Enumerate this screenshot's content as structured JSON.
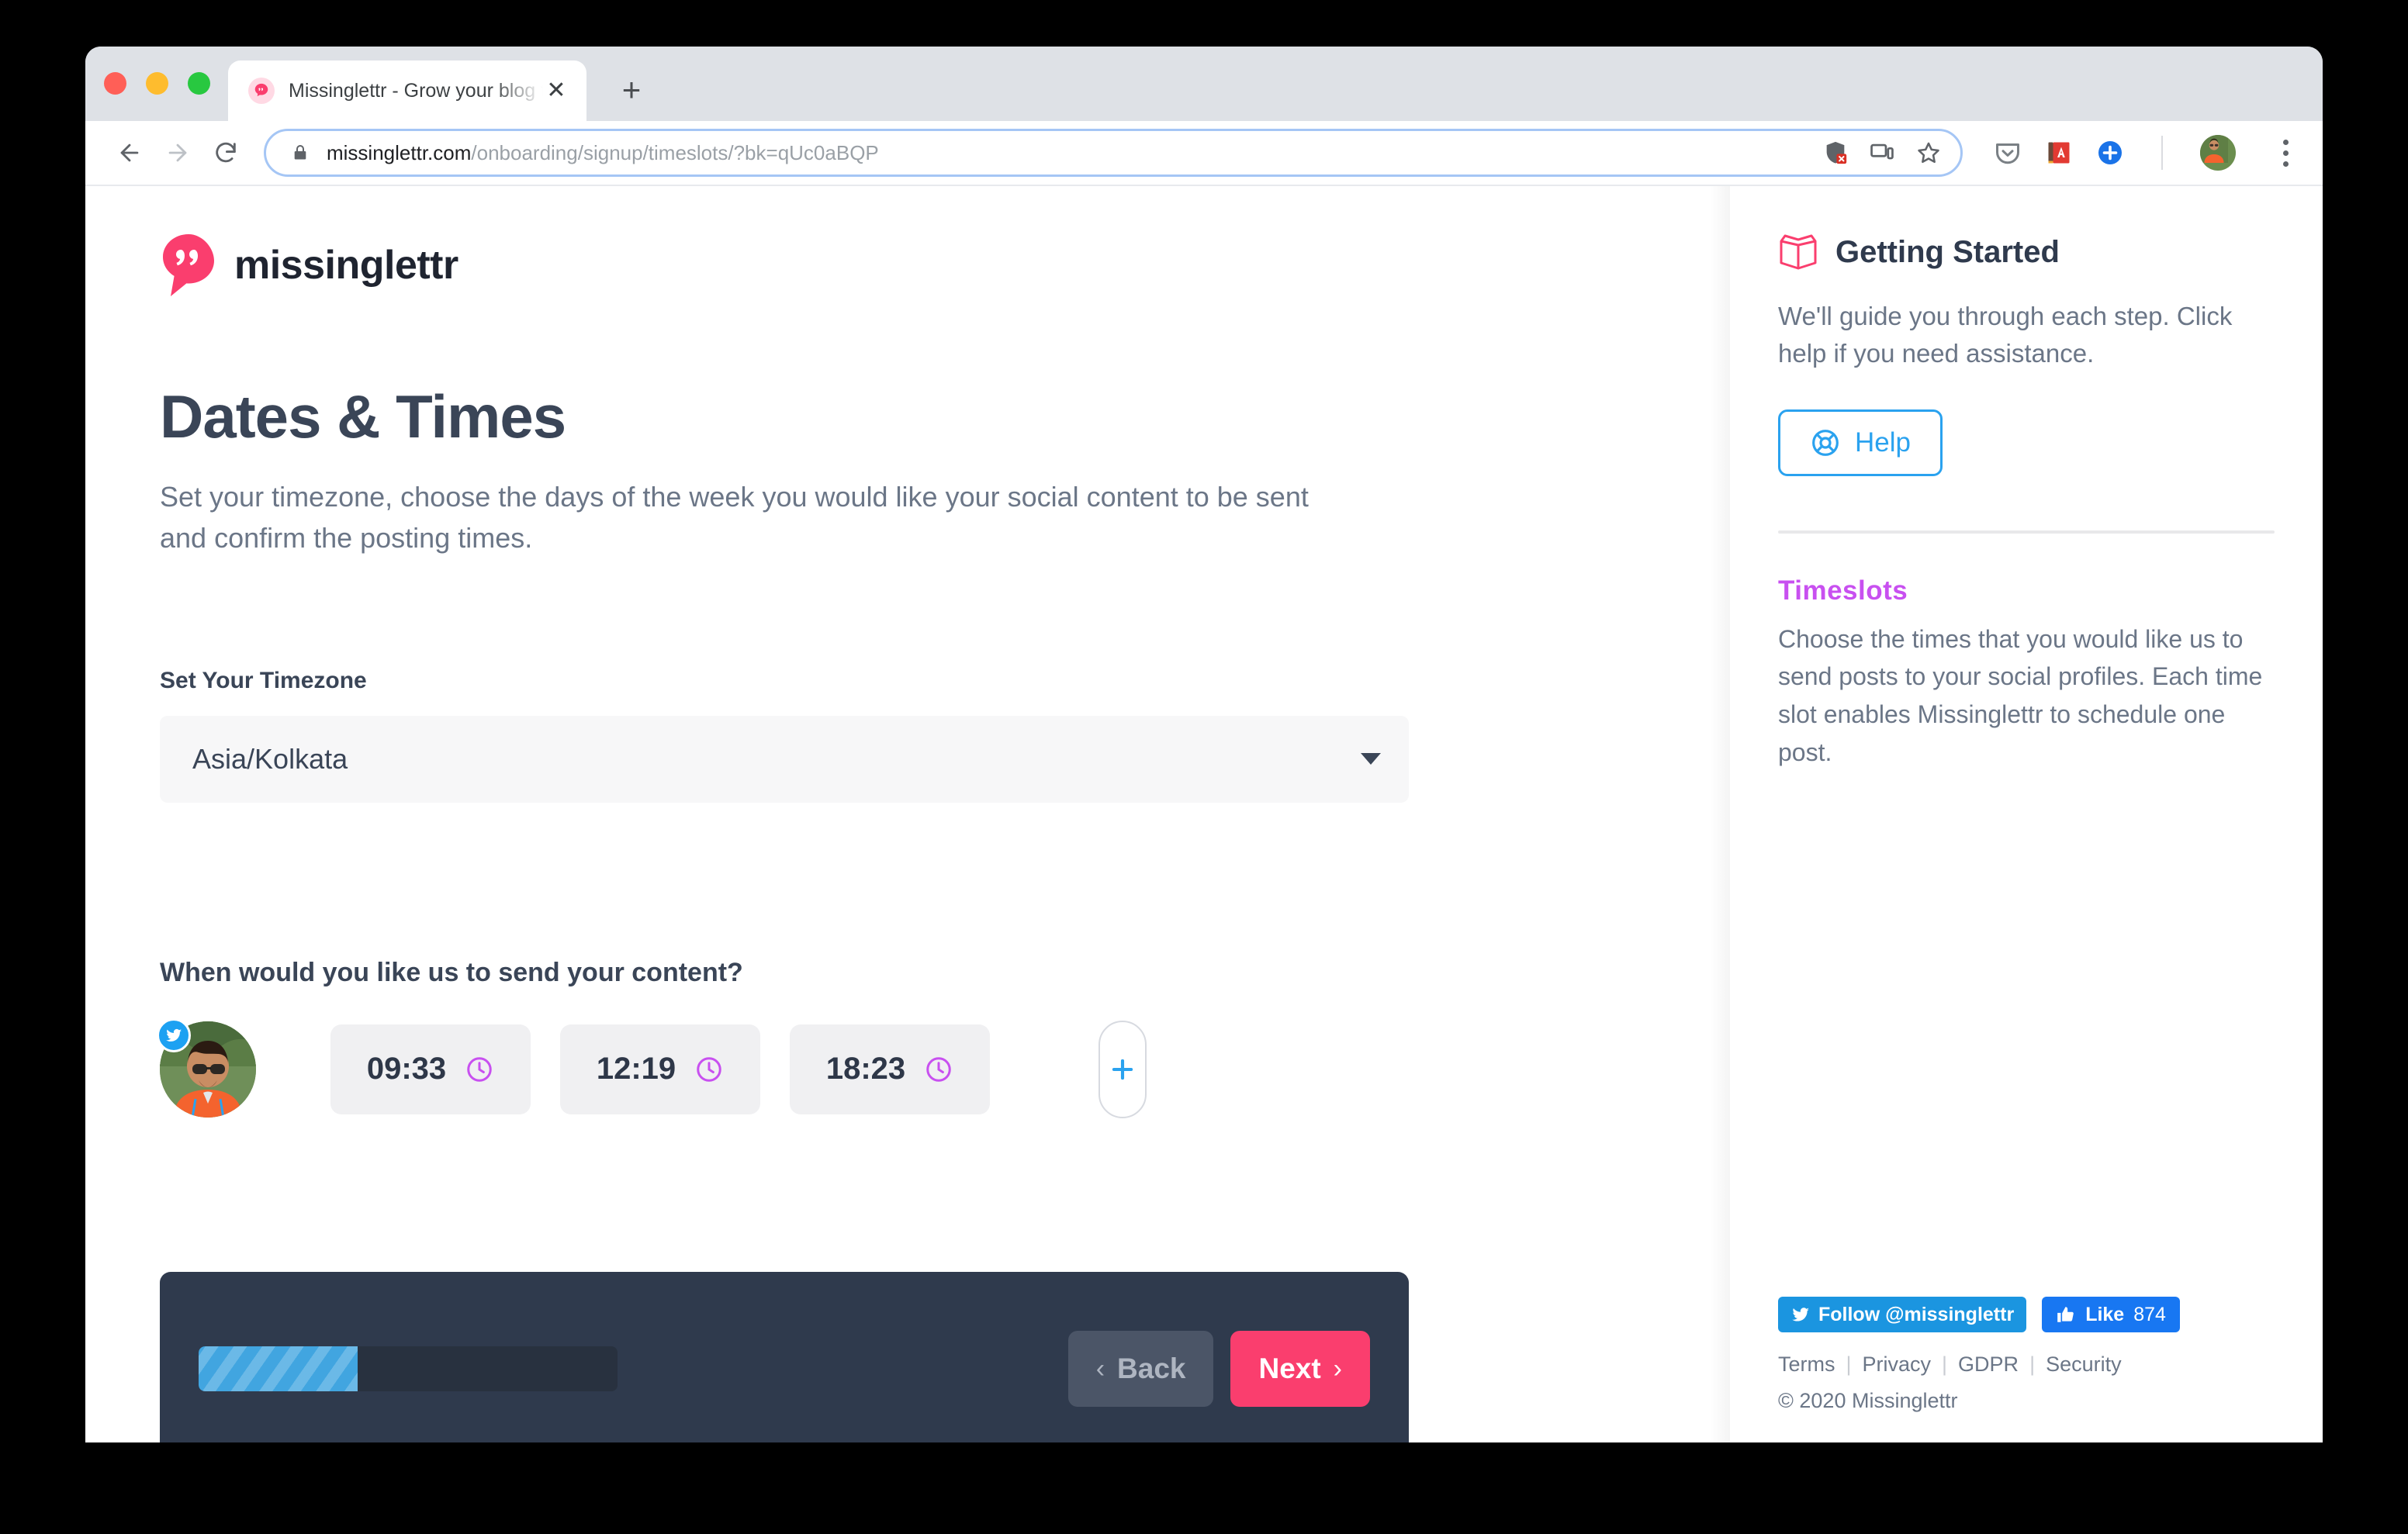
{
  "browser": {
    "tab": {
      "title": "Missinglettr - Grow your blog the",
      "close_label": "✕"
    },
    "newtab_label": "+",
    "url_secure": "missinglettr.com",
    "url_path": "/onboarding/signup/timeslots/?bk=qUc0aBQP"
  },
  "main": {
    "brand": "missinglettr",
    "title": "Dates & Times",
    "subtitle": "Set your timezone, choose the days of the week you would like your social content to be sent and confirm the posting times.",
    "timezone_label": "Set Your Timezone",
    "timezone_value": "Asia/Kolkata",
    "slots_question": "When would you like us to send your content?",
    "timeslots": [
      "09:33",
      "12:19",
      "18:23"
    ],
    "add_slot_label": "+",
    "progress_percent": 38,
    "back_label": "Back",
    "next_label": "Next",
    "back_chevron": "‹",
    "next_chevron": "›"
  },
  "sidebar": {
    "getting_started_title": "Getting Started",
    "getting_started_text": "We'll guide you through each step. Click help if you need assistance.",
    "help_label": "Help",
    "timeslots_title": "Timeslots",
    "timeslots_text": "Choose the times that you would like us to send posts to your social profiles. Each time slot enables Missinglettr to schedule one post.",
    "twitter_follow": "Follow @missinglettr",
    "facebook_like": "Like",
    "facebook_count": "874",
    "legal": [
      "Terms",
      "Privacy",
      "GDPR",
      "Security"
    ],
    "copyright": "© 2020 Missinglettr"
  },
  "colors": {
    "brand_pink": "#fa3e6e",
    "accent_blue": "#2aa2ef",
    "purple": "#c850f0",
    "dark_navy": "#2f3a4d"
  }
}
